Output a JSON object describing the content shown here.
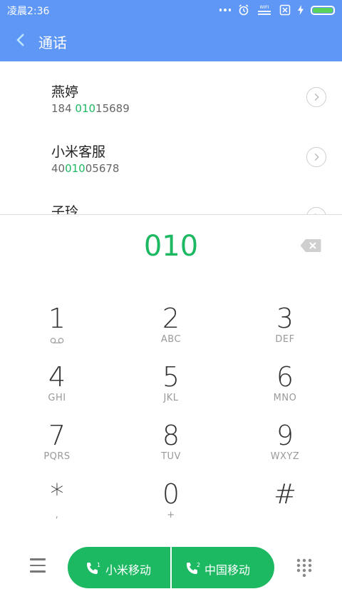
{
  "status_bar": {
    "time": "凌晨2:36",
    "wifi_label": "WIFI",
    "battery_color": "#5ad35a"
  },
  "app_bar": {
    "title": "通话",
    "color": "#5e97f6"
  },
  "results": [
    {
      "name": "燕婷",
      "number_parts": [
        "184 ",
        "010",
        "15689"
      ]
    },
    {
      "name": "小米客服",
      "number_parts": [
        "40",
        "010",
        "05678"
      ]
    },
    {
      "name": "子玲",
      "number_parts": [
        "",
        "",
        ""
      ]
    }
  ],
  "dial_input": "010",
  "keypad": [
    {
      "digit": "1",
      "letters": "",
      "icon": "voicemail-icon"
    },
    {
      "digit": "2",
      "letters": "ABC"
    },
    {
      "digit": "3",
      "letters": "DEF"
    },
    {
      "digit": "4",
      "letters": "GHI"
    },
    {
      "digit": "5",
      "letters": "JKL"
    },
    {
      "digit": "6",
      "letters": "MNO"
    },
    {
      "digit": "7",
      "letters": "PQRS"
    },
    {
      "digit": "8",
      "letters": "TUV"
    },
    {
      "digit": "9",
      "letters": "WXYZ"
    },
    {
      "digit": "*",
      "letters": ","
    },
    {
      "digit": "0",
      "letters": "+"
    },
    {
      "digit": "#",
      "letters": ""
    }
  ],
  "call_buttons": {
    "sim1_label": "小米移动",
    "sim1_badge": "1",
    "sim2_label": "中国移动",
    "sim2_badge": "2",
    "color": "#1db862"
  },
  "icons": {
    "back": "chevron-left-icon",
    "backspace": "backspace-icon",
    "menu": "menu-icon",
    "keypad_toggle": "dialpad-icon"
  }
}
